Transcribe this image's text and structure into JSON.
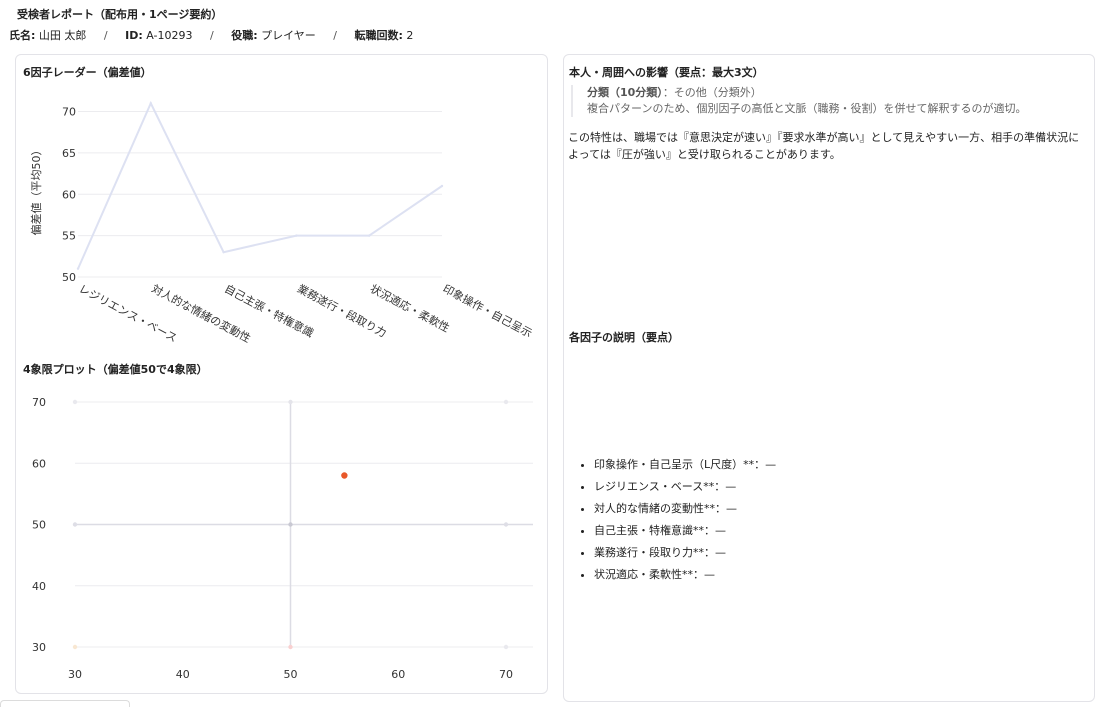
{
  "report": {
    "title": "受検者レポート（配布用・1ページ要約）",
    "name_label": "氏名:",
    "name_value": "山田 太郎",
    "id_label": "ID:",
    "id_value": "A-10293",
    "role_label": "役職:",
    "role_value": "プレイヤー",
    "job_change_label": "転職回数:",
    "job_change_value": "2",
    "separator": "/"
  },
  "radar_section": {
    "title": "6因子レーダー（偏差値）"
  },
  "quadrant_section": {
    "title": "4象限プロット（偏差値50で4象限）"
  },
  "effects_section": {
    "title": "本人・周囲への影響（要点：最大3文）",
    "class_label": "分類（10分類）",
    "class_value": "：その他（分類外）",
    "class_note": "複合パターンのため、個別因子の高低と文脈（職務・役割）を併せて解釈するのが適切。",
    "description": "この特性は、職場では『意思決定が速い』『要求水準が高い』として見えやすい一方、相手の準備状況によっては『圧が強い』と受け取られることがあります。"
  },
  "factors_section": {
    "title": "各因子の説明（要点）",
    "items": [
      "印象操作・自己呈示（L尺度）**：—",
      "レジリエンス・ベース**：—",
      "対人的な情緒の変動性**：—",
      "自己主張・特権意識**：—",
      "業務遂行・段取り力**：—",
      "状況適応・柔軟性**：—"
    ]
  },
  "chart_data": [
    {
      "type": "line",
      "title": "6因子レーダー（偏差値）",
      "ylabel": "偏差値（平均50）",
      "categories": [
        "レジリエンス・ベース",
        "対人的な情緒の変動性",
        "自己主張・特権意識",
        "業務遂行・段取り力",
        "状況適応・柔軟性",
        "印象操作・自己呈示"
      ],
      "values": [
        51,
        71,
        53,
        55,
        55,
        61
      ],
      "yticks": [
        50,
        55,
        60,
        65,
        70
      ],
      "ylim": [
        50,
        72
      ],
      "grid": true,
      "colors": {
        "line": "#dde1f2",
        "grid": "#ececef",
        "text": "#333333"
      }
    },
    {
      "type": "scatter",
      "title": "4象限プロット（偏差値50で4象限）",
      "xticks": [
        30,
        40,
        50,
        60,
        70
      ],
      "yticks": [
        30,
        40,
        50,
        60,
        70
      ],
      "xlim": [
        30,
        70
      ],
      "ylim": [
        30,
        70
      ],
      "grid": true,
      "point": {
        "x": 55,
        "y": 58
      },
      "reference_points": [
        {
          "x": 30,
          "y": 70,
          "color": "#e9e9ee"
        },
        {
          "x": 50,
          "y": 70,
          "color": "#e4e4ea"
        },
        {
          "x": 70,
          "y": 70,
          "color": "#e9e9ee"
        },
        {
          "x": 30,
          "y": 50,
          "color": "#dedee6"
        },
        {
          "x": 50,
          "y": 50,
          "color": "#c9c9d3"
        },
        {
          "x": 70,
          "y": 50,
          "color": "#dedee6"
        },
        {
          "x": 30,
          "y": 30,
          "color": "#f8e7d2"
        },
        {
          "x": 50,
          "y": 30,
          "color": "#f9d0d0"
        },
        {
          "x": 70,
          "y": 30,
          "color": "#e9e9ee"
        }
      ],
      "colors": {
        "point": "#e8582a",
        "midline": "#dcdce4",
        "grid": "#ececef"
      }
    }
  ]
}
